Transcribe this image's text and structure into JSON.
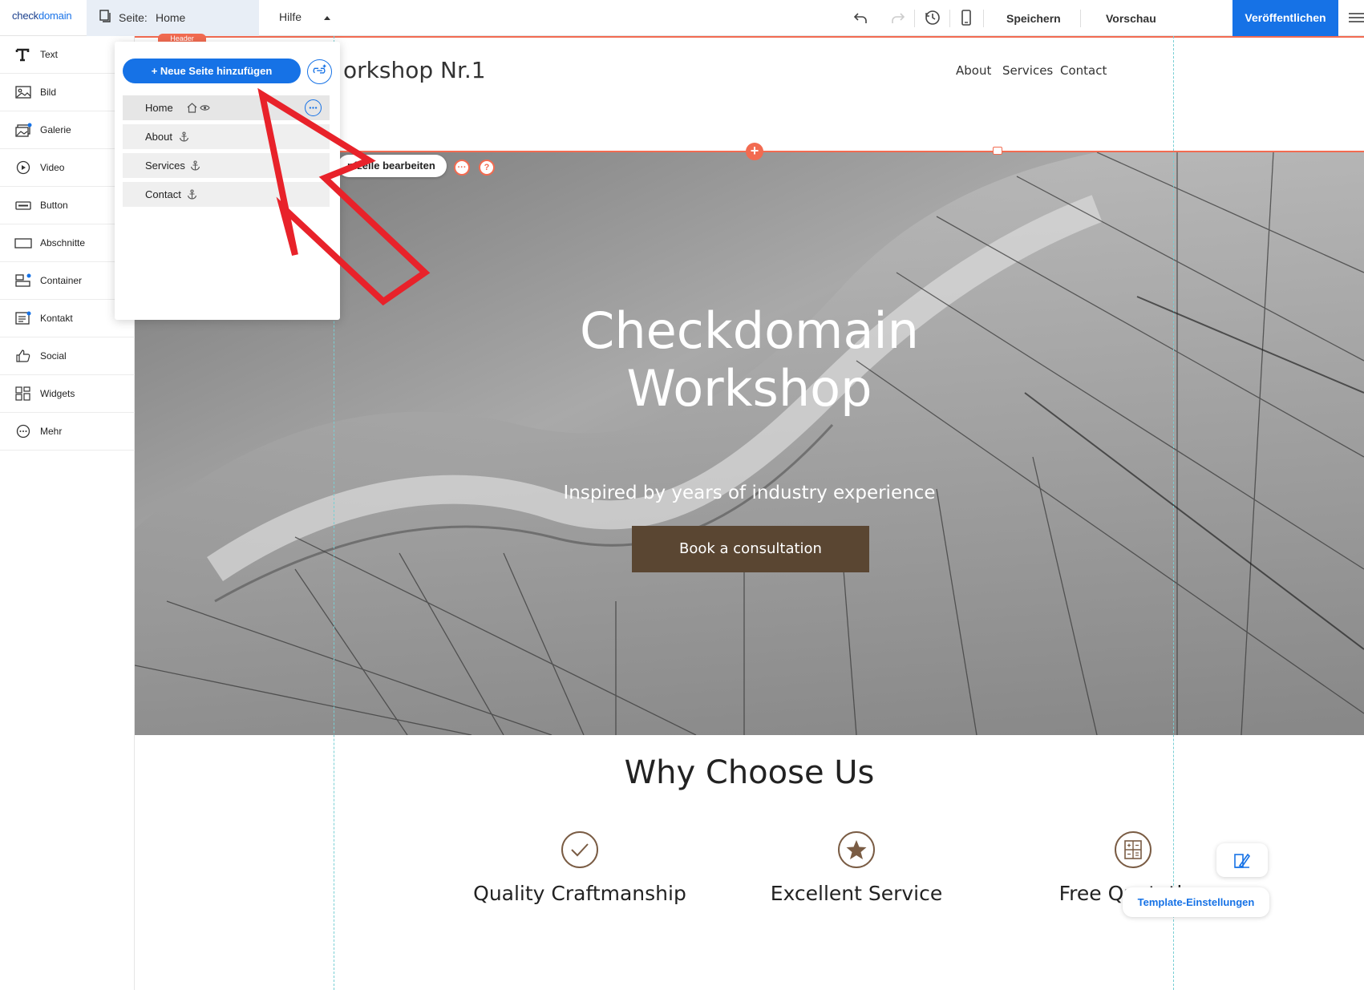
{
  "app": {
    "logo_text_a": "check",
    "logo_text_b": "domain"
  },
  "topbar": {
    "page_prefix": "Seite:",
    "page_name": "Home",
    "help": "Hilfe",
    "save": "Speichern",
    "preview": "Vorschau",
    "publish": "Veröffentlichen"
  },
  "toolbox": {
    "items": [
      {
        "label": "Text",
        "icon": "text-icon"
      },
      {
        "label": "Bild",
        "icon": "image-icon"
      },
      {
        "label": "Galerie",
        "icon": "gallery-icon"
      },
      {
        "label": "Video",
        "icon": "video-icon"
      },
      {
        "label": "Button",
        "icon": "button-icon"
      },
      {
        "label": "Abschnitte",
        "icon": "section-icon"
      },
      {
        "label": "Container",
        "icon": "container-icon"
      },
      {
        "label": "Kontakt",
        "icon": "contact-icon"
      },
      {
        "label": "Social",
        "icon": "thumbs-up-icon"
      },
      {
        "label": "Widgets",
        "icon": "widgets-icon"
      },
      {
        "label": "Mehr",
        "icon": "more-icon"
      }
    ]
  },
  "pages_panel": {
    "header_tag": "Header",
    "add_page": "+ Neue Seite hinzufügen",
    "pages": [
      {
        "name": "Home"
      },
      {
        "name": "About"
      },
      {
        "name": "Services"
      },
      {
        "name": "Contact"
      }
    ]
  },
  "site": {
    "title": "orkshop Nr.1",
    "nav": [
      "About",
      "Services",
      "Contact"
    ],
    "edit_header_btn": "pfzeile bearbeiten",
    "more_btn": "···",
    "help_btn": "?",
    "hero_title_line1": "Checkdomain",
    "hero_title_line2": "Workshop",
    "hero_subtitle": "Inspired by years of industry experience",
    "hero_button": "Book a consultation",
    "why_title": "Why Choose Us",
    "features": [
      {
        "label": "Quality Craftmanship",
        "icon": "checkmark-circle-icon"
      },
      {
        "label": "Excellent Service",
        "icon": "star-circle-icon"
      },
      {
        "label": "Free Quotation",
        "icon": "calculator-circle-icon"
      }
    ]
  },
  "widgets": {
    "template_settings": "Template-Einstellungen"
  },
  "colors": {
    "accent_blue": "#1672e6",
    "editor_orange": "#f26b51",
    "hero_button_brown": "#5a4632",
    "annotation_red": "#e8222a"
  }
}
